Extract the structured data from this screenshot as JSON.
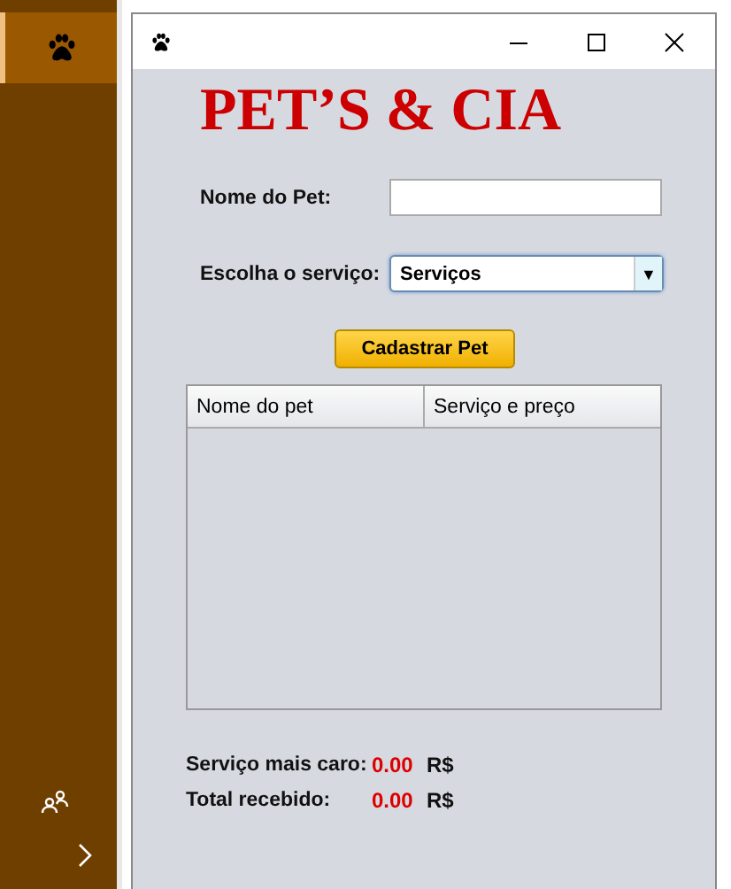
{
  "heading": "PET’S & CIA",
  "pet_name": {
    "label": "Nome do Pet:"
  },
  "service": {
    "label": "Escolha o serviço:",
    "value": "Serviços",
    "arrow": "▼"
  },
  "register_button": "Cadastrar Pet",
  "table": {
    "columns": [
      "Nome do pet",
      "Serviço e preço"
    ]
  },
  "totals": [
    {
      "label": "Serviço mais caro:",
      "amount": "0.00",
      "currency": "R$"
    },
    {
      "label": "Total recebido:",
      "amount": "0.00",
      "currency": "R$"
    }
  ]
}
